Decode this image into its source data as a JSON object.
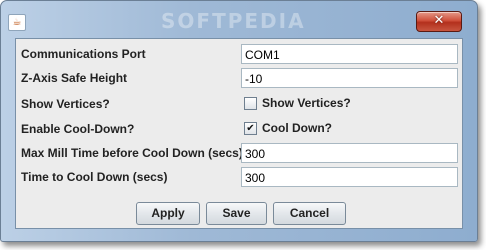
{
  "window": {
    "watermark": "SOFTPEDIA",
    "close_glyph": "✕",
    "app_icon_glyph": "☕"
  },
  "form": {
    "rows": [
      {
        "label": "Communications Port",
        "value": "COM1"
      },
      {
        "label": "Z-Axis Safe Height",
        "value": "-10"
      },
      {
        "label": "Show Vertices?",
        "checkbox_label": "Show Vertices?",
        "checked": false
      },
      {
        "label": "Enable Cool-Down?",
        "checkbox_label": "Cool Down?",
        "checked": true,
        "check_glyph": "✔"
      },
      {
        "label": "Max Mill Time before Cool Down (secs)",
        "value": "300"
      },
      {
        "label": "Time to Cool Down (secs)",
        "value": "300"
      }
    ]
  },
  "buttons": {
    "apply": "Apply",
    "save": "Save",
    "cancel": "Cancel"
  }
}
